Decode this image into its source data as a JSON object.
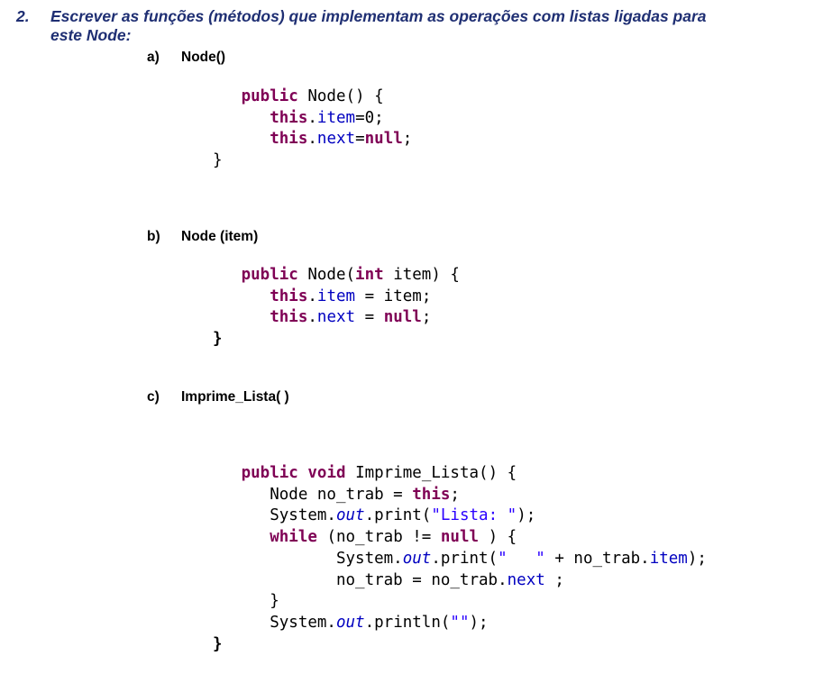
{
  "question": {
    "number": "2.",
    "line1": "Escrever as funções (métodos) que implementam as operações com listas ligadas para",
    "line2": "este Node:"
  },
  "items": [
    {
      "letter": "a)",
      "title": "Node()"
    },
    {
      "letter": "b)",
      "title": "Node (item)"
    },
    {
      "letter": "c)",
      "title": "Imprime_Lista( )"
    }
  ],
  "code_a": {
    "l1_kw": "public",
    "l1_rest": " Node() {",
    "l2_this": "this",
    "l2_dot": ".",
    "l2_field": "item",
    "l2_rest": "=0;",
    "l3_this": "this",
    "l3_dot": ".",
    "l3_field": "next",
    "l3_eq": "=",
    "l3_null": "null",
    "l3_semi": ";",
    "l4": "}"
  },
  "code_b": {
    "l1_kw": "public",
    "l1_mid": " Node(",
    "l1_int": "int",
    "l1_rest": " item) {",
    "l2_this": "this",
    "l2_dot": ".",
    "l2_field": "item",
    "l2_rest": " = item;",
    "l3_this": "this",
    "l3_dot": ".",
    "l3_field": "next",
    "l3_eq": " = ",
    "l3_null": "null",
    "l3_semi": ";",
    "l4": "}"
  },
  "code_c": {
    "l1_public": "public",
    "l1_void": "void",
    "l1_rest": " Imprime_Lista() {",
    "l2_a": "Node no_trab = ",
    "l2_this": "this",
    "l2_semi": ";",
    "l3_a": "System.",
    "l3_out": "out",
    "l3_b": ".print(",
    "l3_str": "\"Lista: \"",
    "l3_c": ");",
    "l4_while": "while",
    "l4_a": " (no_trab != ",
    "l4_null": "null",
    "l4_b": " ) {",
    "l5_a": "System.",
    "l5_out": "out",
    "l5_b": ".print(",
    "l5_str": "\"   \"",
    "l5_c": " + no_trab.",
    "l5_field": "item",
    "l5_d": ");",
    "l6_a": "no_trab = no_trab.",
    "l6_field": "next",
    "l6_b": " ;",
    "l7": "}",
    "l8_a": "System.",
    "l8_out": "out",
    "l8_b": ".println(",
    "l8_str": "\"\"",
    "l8_c": ");",
    "l9": "}"
  }
}
